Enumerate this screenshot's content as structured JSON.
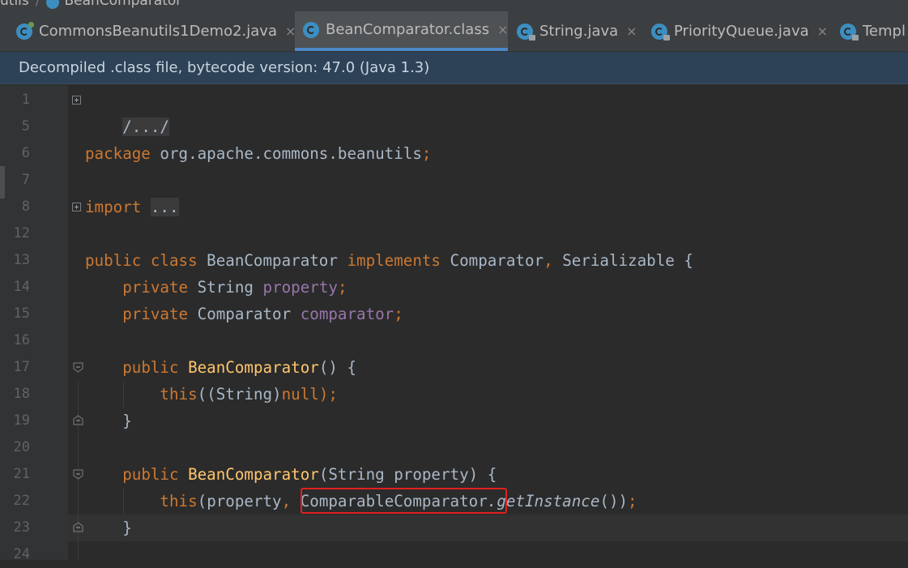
{
  "breadcrumb": {
    "parent": "utils",
    "file": "BeanComparator"
  },
  "tabs": [
    {
      "label": "CommonsBeanutils1Demo2.java",
      "active": false,
      "close": "×"
    },
    {
      "label": "BeanComparator.class",
      "active": true,
      "close": "×"
    },
    {
      "label": "String.java",
      "active": false,
      "close": "×"
    },
    {
      "label": "PriorityQueue.java",
      "active": false,
      "close": "×"
    },
    {
      "label": "Templ",
      "active": false
    }
  ],
  "notice": "Decompiled .class file, bytecode version: 47.0 (Java 1.3)",
  "line_numbers": [
    "1",
    "5",
    "6",
    "7",
    "8",
    "12",
    "13",
    "14",
    "15",
    "16",
    "17",
    "18",
    "19",
    "20",
    "21",
    "22",
    "23",
    "24"
  ],
  "code": {
    "l1": "/.../",
    "l6_kw": "package",
    "l6_rest": " org.apache.commons.beanutils",
    "l6_semi": ";",
    "l8_kw": "import",
    "l8_fold": "...",
    "l13_kw1": "public class",
    "l13_name": " BeanComparator ",
    "l13_kw2": "implements",
    "l13_if1": " Comparator",
    "l13_comma": ",",
    "l13_if2": " Serializable {",
    "l14_kw": "private",
    "l14_type": " String ",
    "l14_field": "property",
    "l14_semi": ";",
    "l15_kw": "private",
    "l15_type": " Comparator ",
    "l15_field": "comparator",
    "l15_semi": ";",
    "l17_kw": "public",
    "l17_fn": " BeanComparator",
    "l17_rest": "() {",
    "l18_kw": "this",
    "l18_mid": "((String)",
    "l18_null": "null",
    "l18_end": ");",
    "l19": "}",
    "l21_kw": "public",
    "l21_fn": " BeanComparator",
    "l21_rest": "(String property) {",
    "l22_kw": "this",
    "l22_a": "(property",
    "l22_comma": ",",
    "l22_cls": " ComparableComparator",
    "l22_call": ".getInstance",
    "l22_end": "())",
    "l22_semi": ";",
    "l23": "}"
  },
  "colors": {
    "keyword": "#cc7832",
    "method": "#ffc66d",
    "field": "#9876aa",
    "text": "#a9b7c6",
    "highlight_box": "#e02020"
  }
}
